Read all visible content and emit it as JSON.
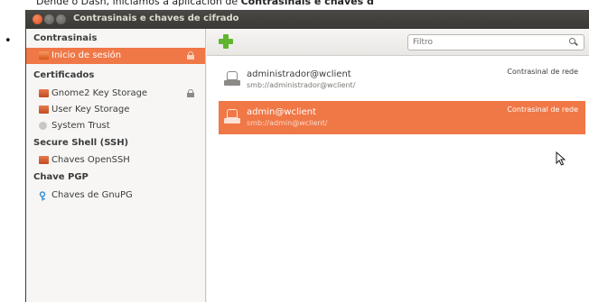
{
  "doc": {
    "intro_plain": "Dende o Dash, iniciamos a aplicación de ",
    "intro_bold": "Contrasinais e chaves d"
  },
  "window": {
    "title": "Contrasinais e chaves de cifrado"
  },
  "sidebar": {
    "sections": [
      {
        "header": "Contrasinais",
        "items": [
          {
            "label": "Inicio de sesión",
            "icon": "keyring-icon",
            "locked": true,
            "selected": true
          }
        ]
      },
      {
        "header": "Certificados",
        "items": [
          {
            "label": "Gnome2 Key Storage",
            "icon": "certificate-icon",
            "locked": true,
            "selected": false
          },
          {
            "label": "User Key Storage",
            "icon": "certificate-icon",
            "locked": false,
            "selected": false
          },
          {
            "label": "System Trust",
            "icon": "trust-icon",
            "locked": false,
            "selected": false
          }
        ]
      },
      {
        "header": "Secure Shell (SSH)",
        "items": [
          {
            "label": "Chaves OpenSSH",
            "icon": "certificate-icon",
            "locked": false,
            "selected": false
          }
        ]
      },
      {
        "header": "Chave PGP",
        "items": [
          {
            "label": "Chaves de GnuPG",
            "icon": "gpg-key-icon",
            "locked": false,
            "selected": false
          }
        ]
      }
    ]
  },
  "toolbar": {
    "search_placeholder": "Filtro"
  },
  "entries": [
    {
      "name": "administrador@wclient",
      "path": "smb://administrador@wclient/",
      "type": "Contrasinal de rede",
      "selected": false
    },
    {
      "name": "admin@wclient",
      "path": "smb://admin@wclient/",
      "type": "Contrasinal de rede",
      "selected": true
    }
  ],
  "colors": {
    "selection": "#f07746",
    "titlebar": "#3c3b37",
    "add": "#5fb52d"
  }
}
